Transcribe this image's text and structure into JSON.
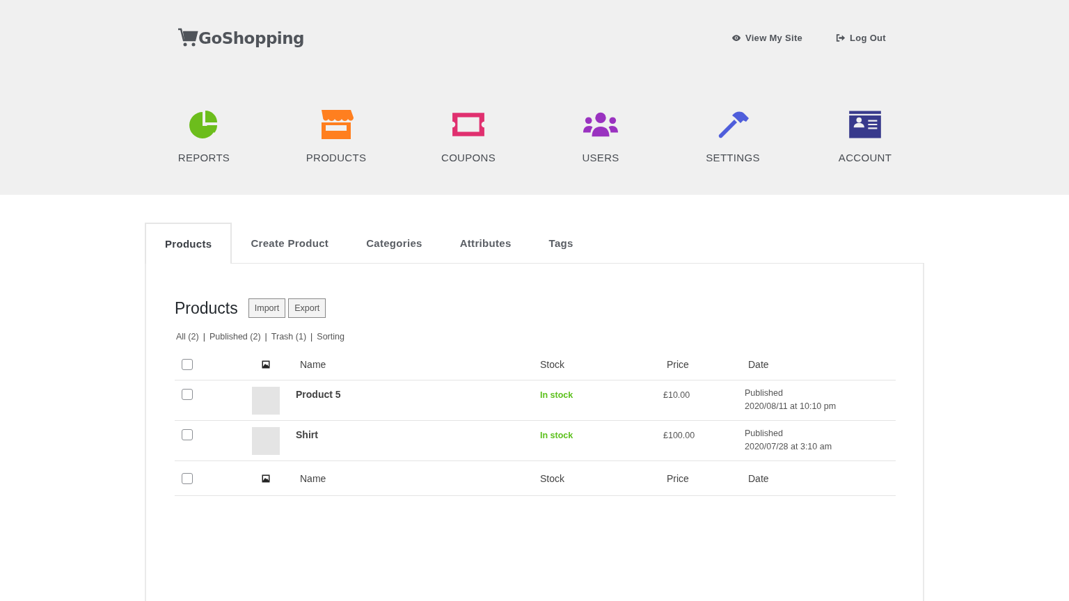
{
  "brand": "GoShopping",
  "top_links": [
    {
      "kind": "view",
      "label": "View My Site"
    },
    {
      "kind": "logout",
      "label": "Log Out"
    }
  ],
  "nav": [
    {
      "kind": "reports",
      "label": "REPORTS",
      "color": "#6cbd1c"
    },
    {
      "kind": "products",
      "label": "PRODUCTS",
      "color": "#ff7f1f"
    },
    {
      "kind": "coupons",
      "label": "COUPONS",
      "color": "#e0306f"
    },
    {
      "kind": "users",
      "label": "USERS",
      "color": "#9a32c0"
    },
    {
      "kind": "settings",
      "label": "SETTINGS",
      "color": "#4f5edb"
    },
    {
      "kind": "account",
      "label": "ACCOUNT",
      "color": "#383a8c"
    }
  ],
  "tabs": [
    {
      "label": "Products",
      "selected": true
    },
    {
      "label": "Create Product",
      "selected": false
    },
    {
      "label": "Categories",
      "selected": false
    },
    {
      "label": "Attributes",
      "selected": false
    },
    {
      "label": "Tags",
      "selected": false
    }
  ],
  "heading": "Products",
  "buttons": [
    "Import",
    "Export"
  ],
  "filters": [
    {
      "label": "All (2)"
    },
    {
      "separator": "|",
      "label": "Published (2)"
    },
    {
      "separator": "|",
      "label": "Trash (1)"
    },
    {
      "separator": "|",
      "label": "Sorting"
    }
  ],
  "columns": [
    "Name",
    "Stock",
    "Price",
    "Date"
  ],
  "rows": [
    {
      "checked": false,
      "name": "Product 5",
      "stock": "In stock",
      "price": "£10.00",
      "status": "Published",
      "date": "2020/08/11 at 10:10 pm"
    },
    {
      "checked": false,
      "name": "Shirt",
      "stock": "In stock",
      "price": "£100.00",
      "status": "Published",
      "date": "2020/07/28 at 3:10 am"
    }
  ],
  "footer_columns": [
    "Name",
    "Stock",
    "Price",
    "Date"
  ],
  "header_checked": false,
  "footer_checked": false
}
